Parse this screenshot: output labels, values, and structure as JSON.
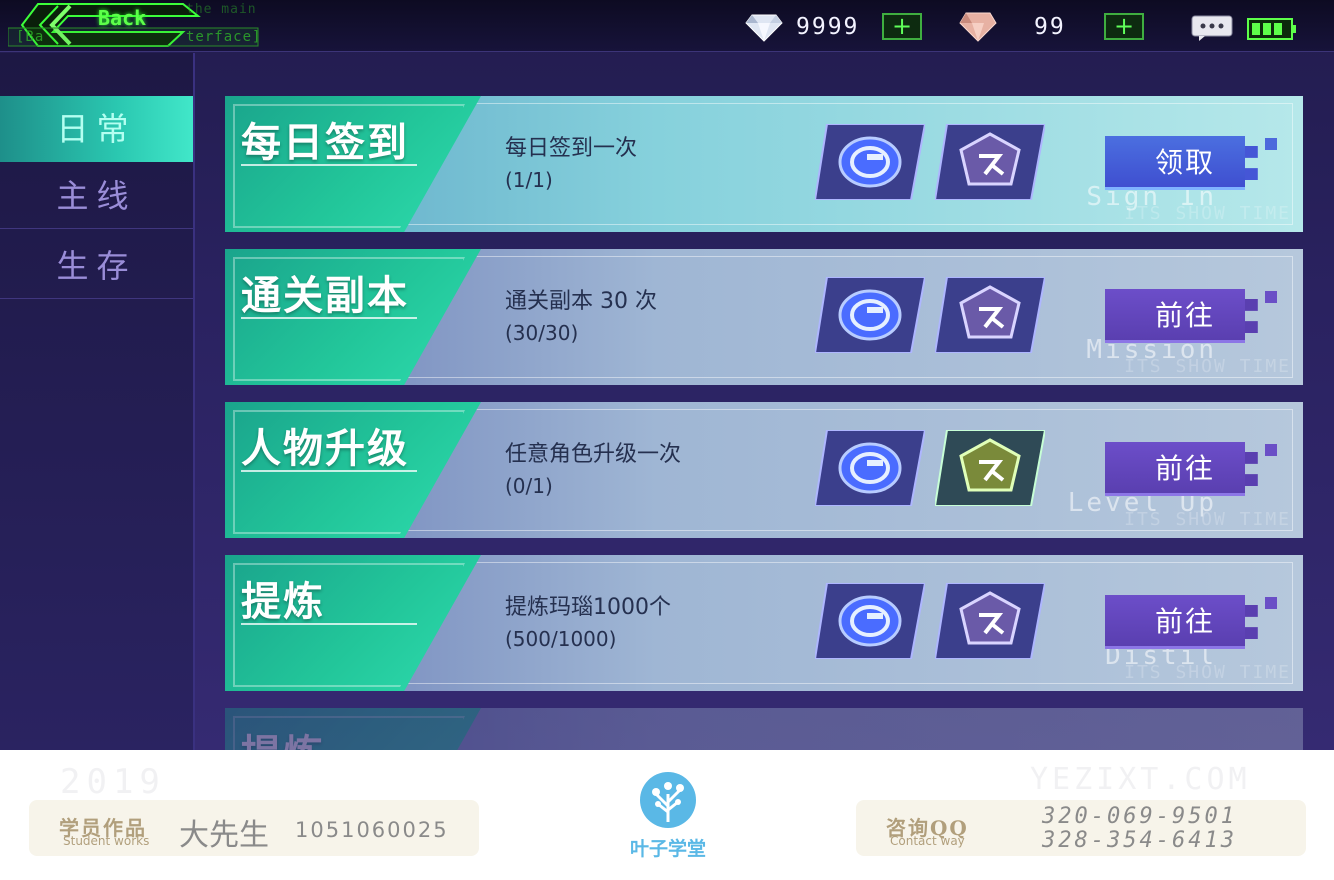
{
  "topbar": {
    "back_label": "Back",
    "back_sub_left": "[Ba",
    "back_sub_right": "terface]",
    "back_top_ghost": "the main",
    "diamond_value": "9999",
    "gem_value": "99",
    "plus_symbol": "+"
  },
  "sidebar": {
    "items": [
      {
        "label": "日常"
      },
      {
        "label": "主线"
      },
      {
        "label": "生存"
      }
    ]
  },
  "tasks": [
    {
      "title": "每日签到",
      "subtitle": "Sign In",
      "description": "每日签到一次",
      "progress": "(1/1)",
      "action": "领取",
      "watermark": "ITS SHOW TIME"
    },
    {
      "title": "通关副本",
      "subtitle": "Mission",
      "description": "通关副本 30 次",
      "progress": "(30/30)",
      "action": "前往",
      "watermark": "ITS SHOW TIME"
    },
    {
      "title": "人物升级",
      "subtitle": "Level Up",
      "description": "任意角色升级一次",
      "progress": "(0/1)",
      "action": "前往",
      "watermark": "ITS SHOW TIME"
    },
    {
      "title": "提炼",
      "subtitle": "Distil",
      "description": "提炼玛瑙1000个",
      "progress": "(500/1000)",
      "action": "前往",
      "watermark": "ITS SHOW TIME"
    }
  ],
  "partial_task": {
    "title": "提炼"
  },
  "footer": {
    "year": "2019",
    "site": "YEZIXT.COM",
    "caption_left": "学员作品",
    "caption_left_sub": "Student works",
    "student_name": "大先生",
    "student_id": "1051060025",
    "logo_text": "叶子学堂",
    "caption_right": "咨询QQ",
    "caption_right_sub": "Contact way",
    "phone_1": "320-069-9501",
    "phone_2": "328-354-6413"
  },
  "colors": {
    "accent_green": "#2fdcae",
    "button_purple": "#5a3fb0",
    "button_blue": "#3f4fd0",
    "plus_green": "#60ff5a"
  },
  "icons": [
    "back-arrow-icon",
    "diamond-icon",
    "gem-icon",
    "plus-icon",
    "chat-icon",
    "battery-icon",
    "reward-coin-icon",
    "reward-shield-icon",
    "tree-logo-icon"
  ]
}
